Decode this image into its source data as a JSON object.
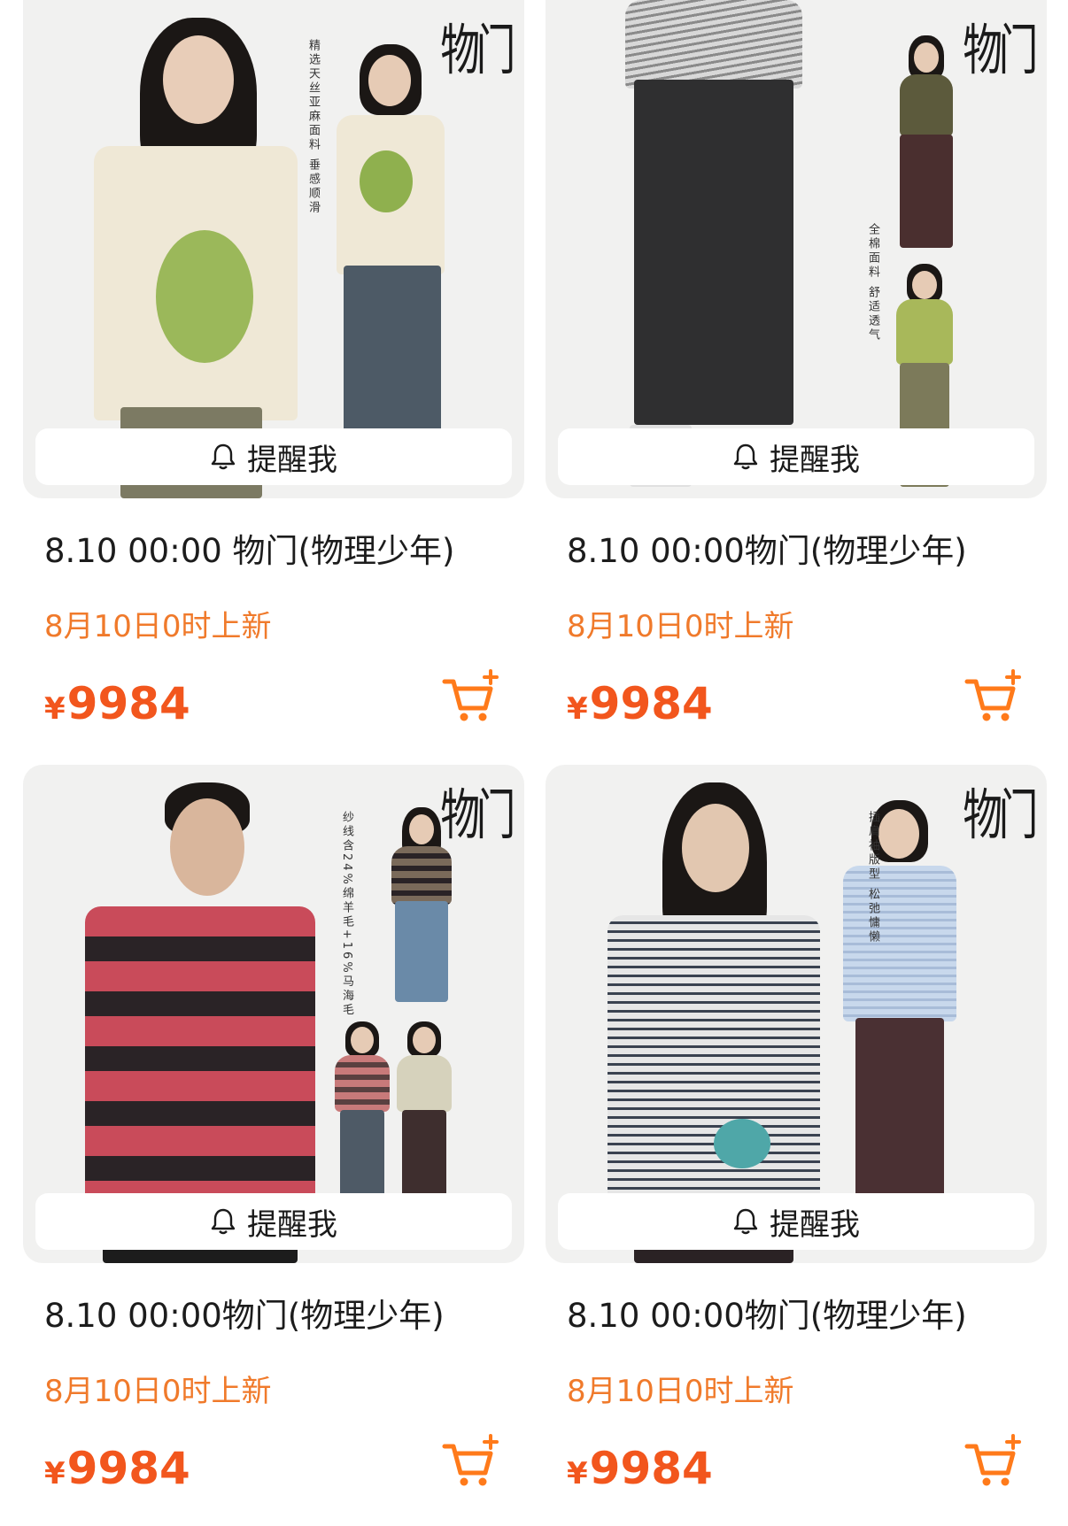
{
  "colors": {
    "accent_orange": "#f07a2b",
    "price_red": "#f2561d",
    "cart_orange": "#ff7a1a",
    "image_bg": "#f1f1f0"
  },
  "products": [
    {
      "brand_mark": "物门",
      "feature_text": "精选天丝亚麻面料 垂感顺滑",
      "remind_label": "提醒我",
      "title": "8.10 00:00 物门(物理少年)",
      "subtitle": "8月10日0时上新",
      "currency": "¥",
      "price": "9984",
      "icons": [
        "bell-icon",
        "cart-add-icon"
      ]
    },
    {
      "brand_mark": "物门",
      "feature_text": "全棉面料 舒适透气",
      "remind_label": "提醒我",
      "title": "8.10 00:00物门(物理少年)",
      "subtitle": "8月10日0时上新",
      "currency": "¥",
      "price": "9984",
      "icons": [
        "bell-icon",
        "cart-add-icon"
      ]
    },
    {
      "brand_mark": "物门",
      "feature_text": "纱线含24%绵羊毛+16%马海毛",
      "remind_label": "提醒我",
      "title": "8.10 00:00物门(物理少年)",
      "subtitle": "8月10日0时上新",
      "currency": "¥",
      "price": "9984",
      "icons": [
        "bell-icon",
        "cart-add-icon"
      ]
    },
    {
      "brand_mark": "物门",
      "feature_text": "插肩袖版型 松弛慵懒",
      "remind_label": "提醒我",
      "title": "8.10 00:00物门(物理少年)",
      "subtitle": "8月10日0时上新",
      "currency": "¥",
      "price": "9984",
      "icons": [
        "bell-icon",
        "cart-add-icon"
      ]
    }
  ]
}
